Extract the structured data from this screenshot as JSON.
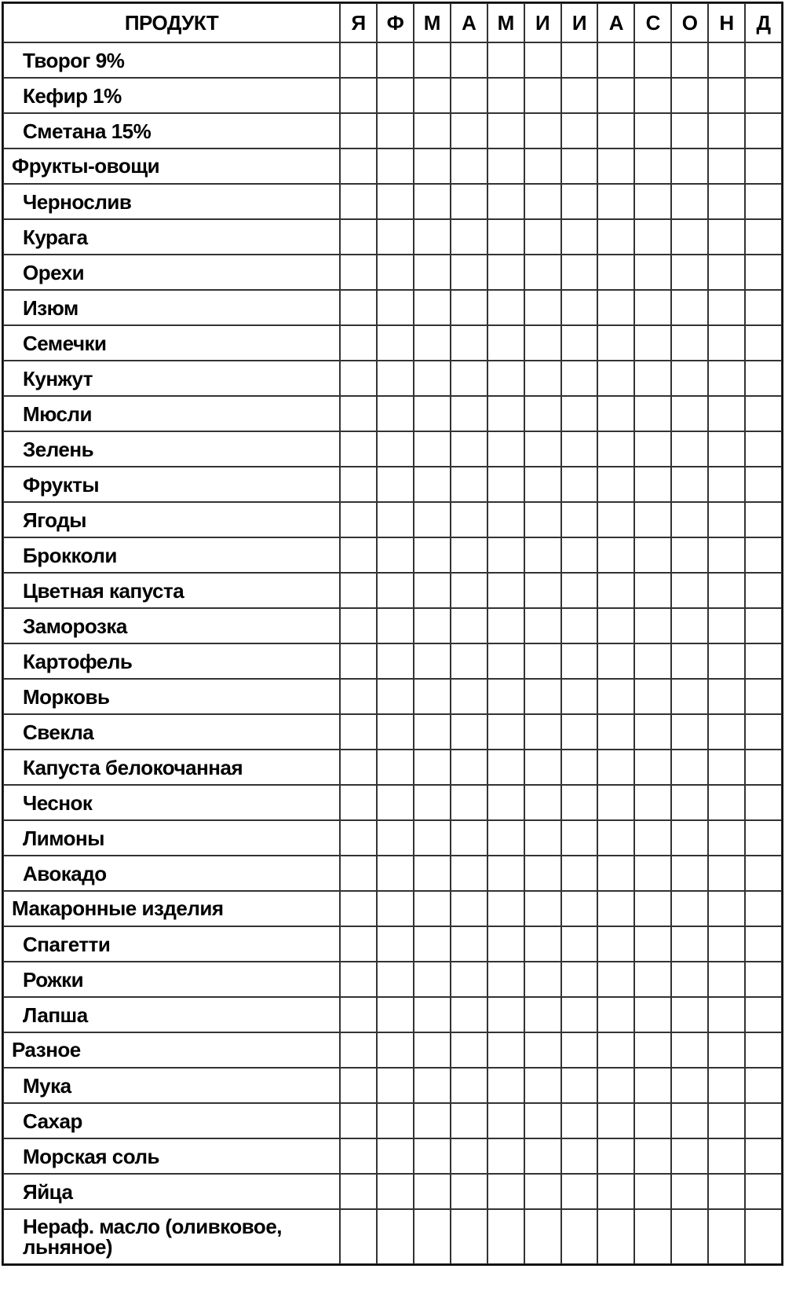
{
  "header": {
    "product_label": "ПРОДУКТ",
    "months": [
      "Я",
      "Ф",
      "М",
      "А",
      "М",
      "И",
      "И",
      "А",
      "С",
      "О",
      "Н",
      "Д"
    ]
  },
  "rows": [
    {
      "type": "item",
      "label": "Творог 9%"
    },
    {
      "type": "item",
      "label": "Кефир 1%"
    },
    {
      "type": "item",
      "label": "Сметана 15%"
    },
    {
      "type": "category",
      "label": "Фрукты-овощи"
    },
    {
      "type": "item",
      "label": "Чернослив"
    },
    {
      "type": "item",
      "label": "Курага"
    },
    {
      "type": "item",
      "label": "Орехи"
    },
    {
      "type": "item",
      "label": "Изюм"
    },
    {
      "type": "item",
      "label": "Семечки"
    },
    {
      "type": "item",
      "label": "Кунжут"
    },
    {
      "type": "item",
      "label": "Мюсли"
    },
    {
      "type": "item",
      "label": "Зелень"
    },
    {
      "type": "item",
      "label": "Фрукты"
    },
    {
      "type": "item",
      "label": "Ягоды"
    },
    {
      "type": "item",
      "label": "Брокколи"
    },
    {
      "type": "item",
      "label": "Цветная капуста"
    },
    {
      "type": "item",
      "label": "Заморозка"
    },
    {
      "type": "item",
      "label": "Картофель"
    },
    {
      "type": "item",
      "label": "Морковь"
    },
    {
      "type": "item",
      "label": "Свекла"
    },
    {
      "type": "item",
      "label": "Капуста белокочанная"
    },
    {
      "type": "item",
      "label": "Чеснок"
    },
    {
      "type": "item",
      "label": "Лимоны"
    },
    {
      "type": "item",
      "label": "Авокадо"
    },
    {
      "type": "category",
      "label": "Макаронные изделия"
    },
    {
      "type": "item",
      "label": "Спагетти"
    },
    {
      "type": "item",
      "label": "Рожки"
    },
    {
      "type": "item",
      "label": "Лапша"
    },
    {
      "type": "category",
      "label": "Разное"
    },
    {
      "type": "item",
      "label": "Мука"
    },
    {
      "type": "item",
      "label": "Сахар"
    },
    {
      "type": "item",
      "label": "Морская соль"
    },
    {
      "type": "item",
      "label": "Яйца"
    },
    {
      "type": "item",
      "label": "Нераф. масло (оливковое, льняное)",
      "tall": true
    }
  ]
}
